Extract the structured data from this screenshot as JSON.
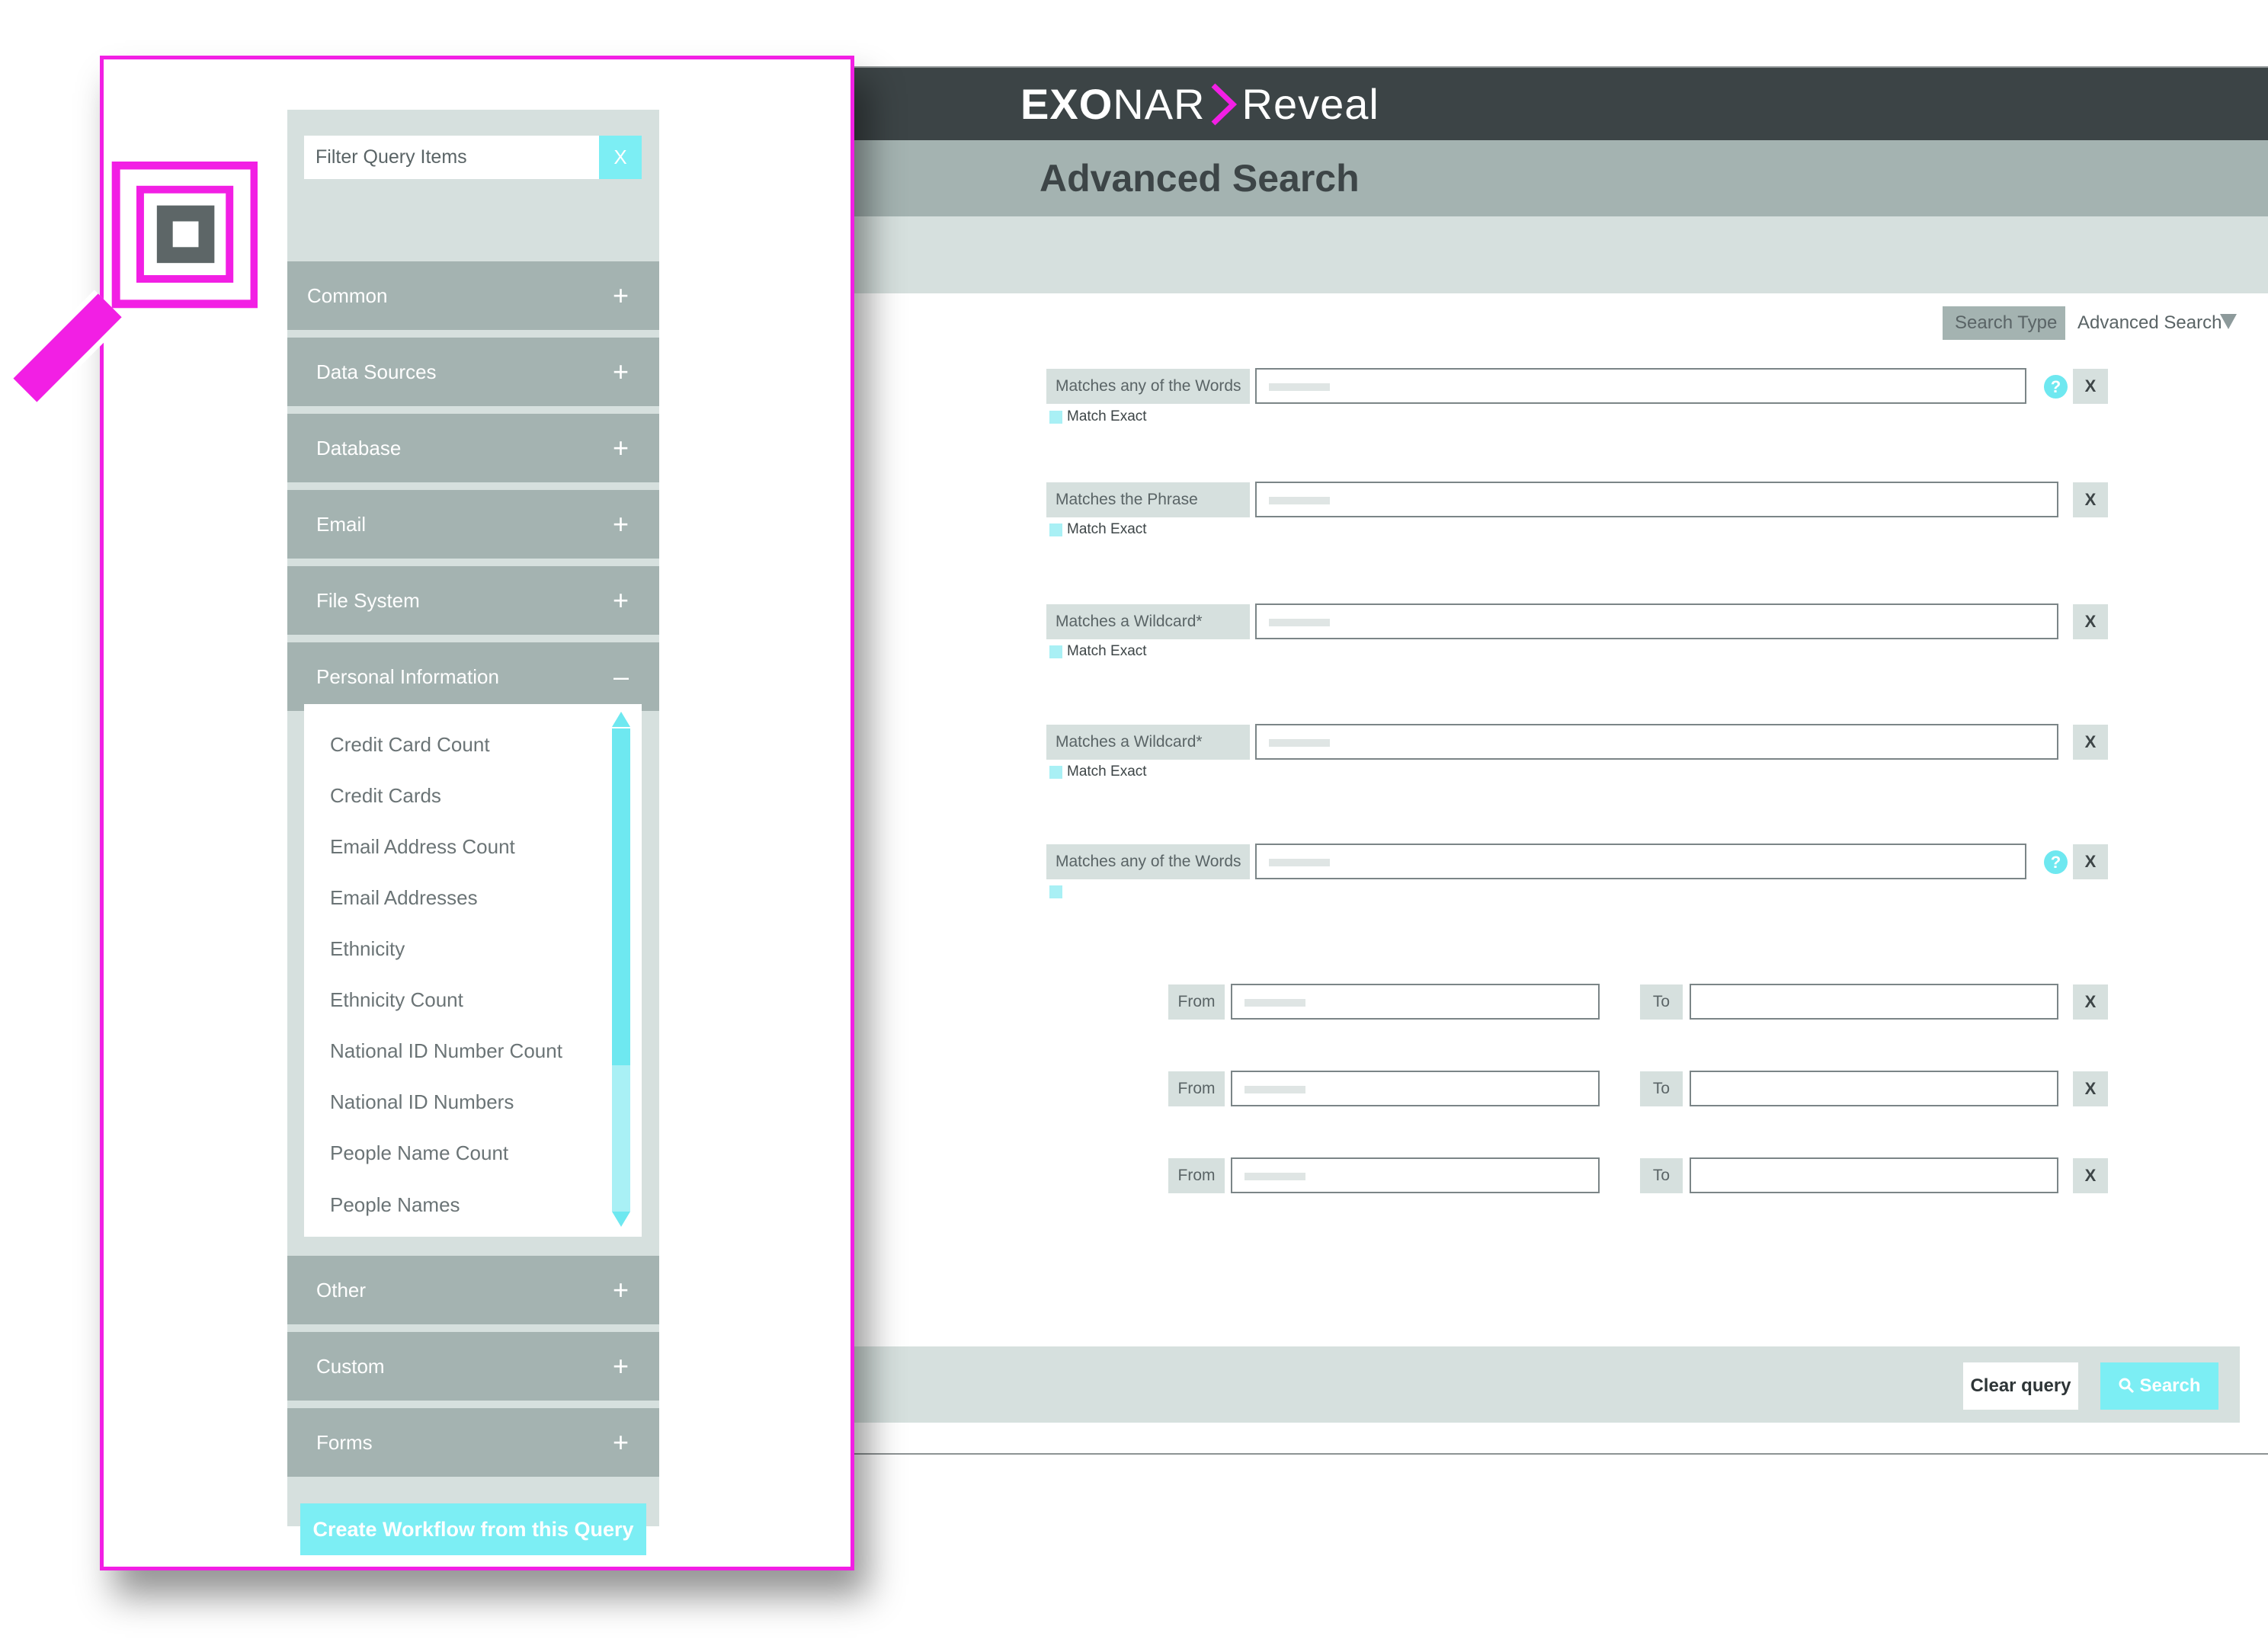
{
  "app": {
    "brand": {
      "part1": "EXO",
      "part2": "NAR",
      "part3": "Reveal"
    },
    "page_title": "Advanced Search",
    "search_type": {
      "label": "Search Type",
      "value": "Advanced Search"
    },
    "rules": [
      {
        "label": "Matches any of the Words",
        "match_label": "Match Exact"
      },
      {
        "label": "Matches the Phrase",
        "match_label": "Match Exact"
      },
      {
        "label": "Matches a Wildcard*",
        "match_label": "Match Exact"
      },
      {
        "label": "Matches a Wildcard*",
        "match_label": "Match Exact"
      },
      {
        "label": "Matches any of the Words",
        "match_label": ""
      }
    ],
    "remove_label": "X",
    "help_label": "?",
    "ranges": [
      {
        "from_label": "From",
        "to_label": "To"
      },
      {
        "from_label": "From",
        "to_label": "To"
      },
      {
        "from_label": "From",
        "to_label": "To"
      }
    ],
    "clear_query_label": "Clear query",
    "search_label": "Search"
  },
  "panel": {
    "filter_placeholder": "Filter Query Items",
    "filter_clear_label": "X",
    "categories_top": [
      {
        "label": "Common",
        "toggle": "+"
      },
      {
        "label": "Data Sources",
        "toggle": "+"
      },
      {
        "label": "Database",
        "toggle": "+"
      },
      {
        "label": "Email",
        "toggle": "+"
      },
      {
        "label": "File System",
        "toggle": "+"
      }
    ],
    "expanded_category": {
      "label": "Personal Information",
      "toggle": "–"
    },
    "personal_info_items": [
      "Credit Card Count",
      "Credit Cards",
      "Email Address Count",
      "Email Addresses",
      "Ethnicity",
      "Ethnicity Count",
      "National ID Number Count",
      "National ID Numbers",
      "People Name Count",
      "People Names"
    ],
    "categories_bottom": [
      {
        "label": "Other",
        "toggle": "+"
      },
      {
        "label": "Custom",
        "toggle": "+"
      },
      {
        "label": "Forms",
        "toggle": "+"
      }
    ],
    "create_workflow_label": "Create Workflow from this Query"
  },
  "colors": {
    "accent_magenta": "#f21fe4",
    "accent_cyan": "#7ceef4",
    "topbar": "#3c4446",
    "category_bg": "#a4b3b1",
    "panel_bg": "#d6e0de"
  },
  "icons": [
    "exonar-chevron-icon",
    "dropdown-triangle-icon",
    "help-icon",
    "remove-icon",
    "search-icon",
    "magnifier-icon",
    "plus-icon",
    "minus-icon",
    "scroll-up-icon",
    "scroll-down-icon"
  ]
}
